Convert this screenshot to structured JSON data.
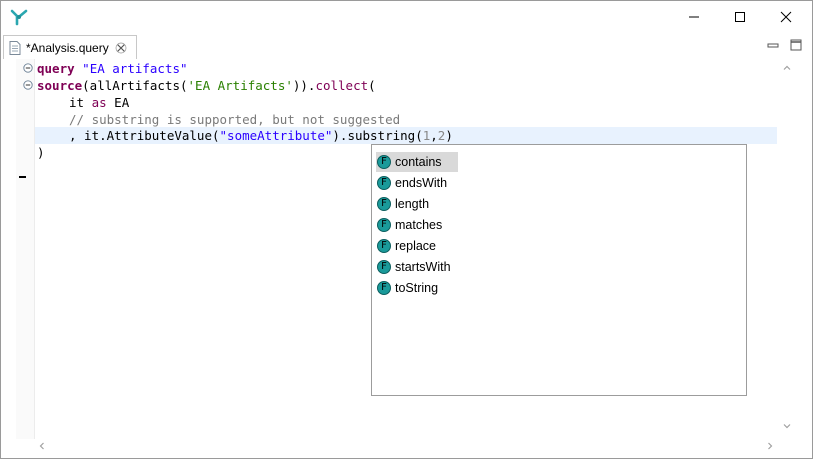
{
  "window": {
    "controls": {
      "minimize": "minimize-icon",
      "maximize": "maximize-icon",
      "close": "close-icon"
    }
  },
  "tab": {
    "label": "*Analysis.query"
  },
  "code": {
    "line1": {
      "kw": "query",
      "str": "\"EA artifacts\""
    },
    "line2": {
      "kw": "source",
      "a": "(allArtifacts(",
      "str": "'EA Artifacts'",
      "b": ")).",
      "kw2": "collect",
      "c": "("
    },
    "line3": {
      "a": "it ",
      "kw": "as",
      "b": " EA"
    },
    "line4": {
      "comment": "// substring is supported, but not suggested"
    },
    "line5": {
      "a": ", it.AttributeValue(",
      "str": "\"someAttribute\"",
      "b": ").substring(",
      "n1": "1",
      "c": ",",
      "n2": "2",
      "d": ")"
    },
    "line6": {
      "a": ")"
    }
  },
  "autocomplete": {
    "icon_letter": "F",
    "items": [
      {
        "label": "contains",
        "selected": true
      },
      {
        "label": "endsWith"
      },
      {
        "label": "length"
      },
      {
        "label": "matches"
      },
      {
        "label": "replace"
      },
      {
        "label": "startsWith"
      },
      {
        "label": "toString"
      }
    ]
  },
  "colors": {
    "keyword": "#7f0055",
    "string": "#2a00ff",
    "comment": "#7a7a7a",
    "current_line": "#e8f2fe",
    "function_icon": "#1a9a9a"
  }
}
